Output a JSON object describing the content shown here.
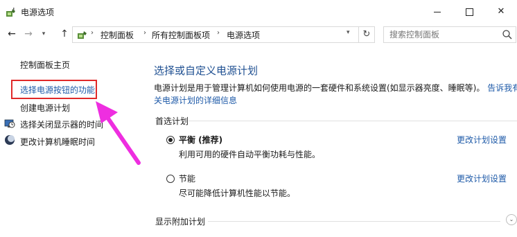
{
  "window": {
    "title": "电源选项",
    "minimize": "minimize",
    "maximize": "maximize",
    "close": "✕"
  },
  "nav": {
    "back": "←",
    "forward": "→",
    "recent": "▾",
    "up": "↑"
  },
  "address": {
    "crumbs": [
      "控制面板",
      "所有控制面板项",
      "电源选项"
    ],
    "separator": "›",
    "dropdown": "▾",
    "refresh": "↻"
  },
  "search": {
    "placeholder": "搜索控制面板"
  },
  "sidebar": {
    "items": [
      {
        "label": "控制面板主页"
      },
      {
        "label": "选择电源按钮的功能"
      },
      {
        "label": "创建电源计划"
      },
      {
        "label": "选择关闭显示器的时间"
      },
      {
        "label": "更改计算机睡眠时间"
      }
    ]
  },
  "main": {
    "title": "选择或自定义电源计划",
    "desc_line1": "电源计划是用于管理计算机如何使用电源的一套硬件和系统设置(如显示器亮度、睡眠等)。",
    "desc_link1": "告诉我有",
    "desc_link2": "关电源计划的详细信息",
    "preferred_label": "首选计划",
    "plans": [
      {
        "name": "平衡 (推荐)",
        "desc": "利用可用的硬件自动平衡功耗与性能。",
        "link": "更改计划设置",
        "selected": true
      },
      {
        "name": "节能",
        "desc": "尽可能降低计算机性能以节能。",
        "link": "更改计划设置",
        "selected": false
      }
    ],
    "extra_label": "显示附加计划",
    "extra_chevron": "⌄"
  },
  "colors": {
    "link": "#1e5aa8",
    "title": "#1e4f91",
    "highlight_box": "#e02828",
    "arrow": "#ee2ee0"
  }
}
